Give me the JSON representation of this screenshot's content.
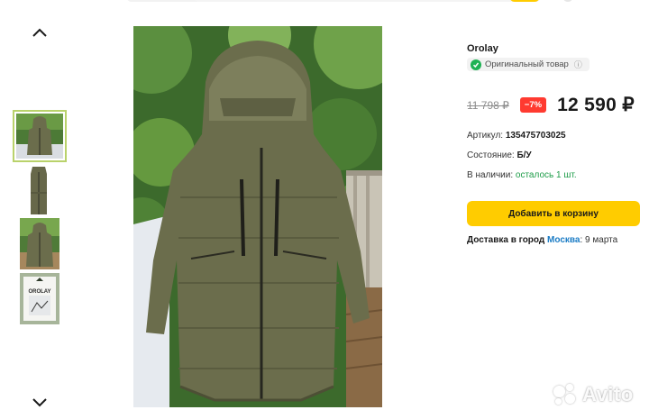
{
  "product": {
    "brand": "Orolay",
    "original_badge": "Оригинальный товар",
    "old_price": "11 798 ₽",
    "discount": "−7%",
    "price": "12 590 ₽",
    "article_label": "Артикул:",
    "article_value": "135475703025",
    "condition_label": "Состояние:",
    "condition_value": "Б/У",
    "stock_label": "В наличии:",
    "stock_value": "осталось 1 шт.",
    "cart_button": "Добавить в корзину",
    "delivery_label": "Доставка в город",
    "delivery_city": "Москва",
    "delivery_date": ": 9 марта"
  },
  "gallery": {
    "thumbnail_count": 4,
    "selected_index": 0,
    "thumb_label": "OROLAY"
  },
  "watermark": "Avito",
  "colors": {
    "accent_yellow": "#ffcc00",
    "discount_red": "#ff3a30",
    "stock_green": "#1d9c48",
    "link_blue": "#1b7cc5",
    "thumb_selected_border": "#b9d26b",
    "jacket_olive": "#6b6d4c"
  }
}
